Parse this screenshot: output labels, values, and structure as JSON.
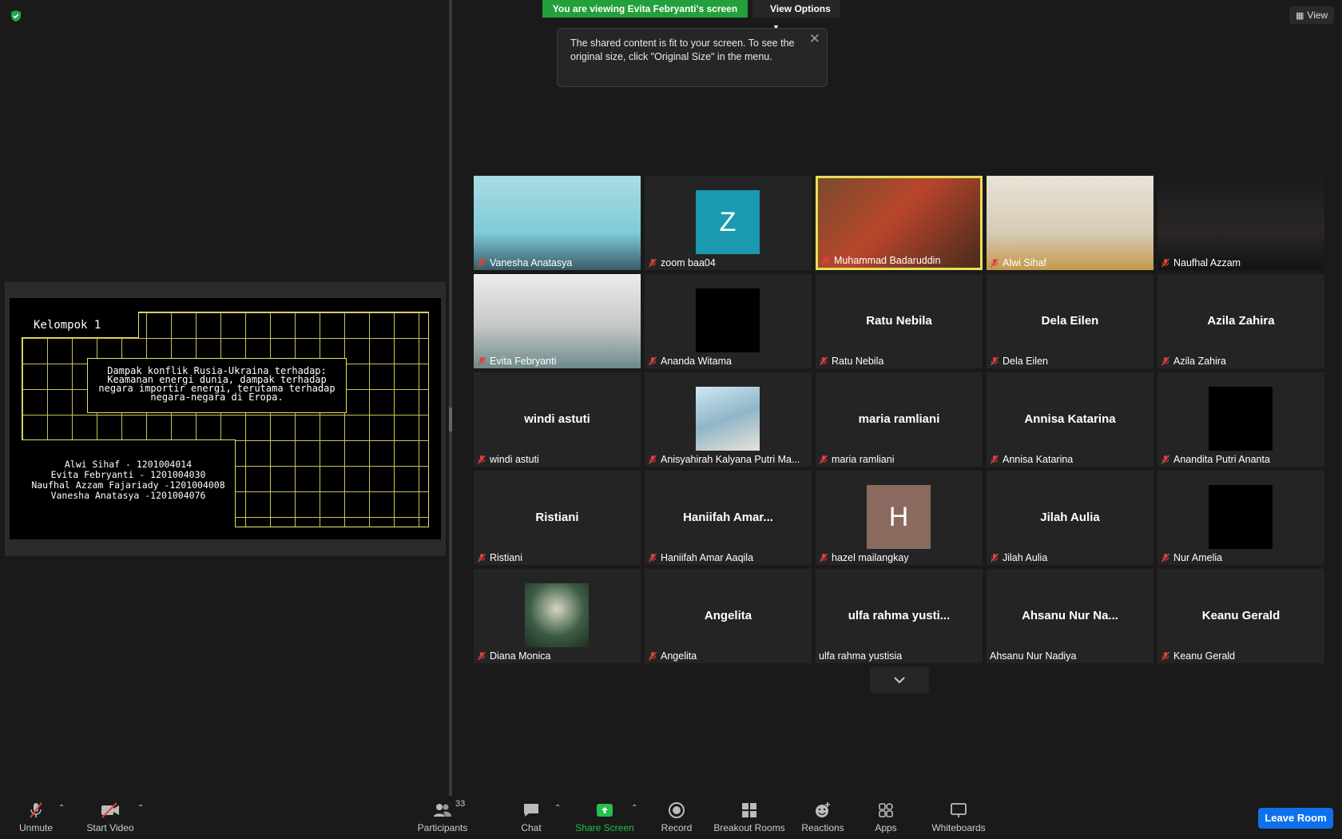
{
  "banner": {
    "viewing": "You are viewing Evita Febryanti's screen",
    "view_options": "View Options"
  },
  "tooltip": {
    "text": "The shared content is fit to your screen. To see the original size, click \"Original Size\" in the menu.",
    "close": "✕"
  },
  "view_button": "View",
  "slide": {
    "title": "Kelompok 1",
    "main": [
      "Dampak konflik Rusia-Ukraina terhadap:",
      "Keamanan energi dunia, dampak terhadap",
      "negara importir energi, terutama terhadap",
      "negara-negara di Eropa."
    ],
    "names": [
      "Alwi Sihaf - 1201004014",
      "Evita Febryanti - 1201004030",
      "Naufhal Azzam Fajariady -1201004008",
      "Vanesha Anatasya -1201004076"
    ]
  },
  "participants": [
    {
      "label": "Vanesha Anatasya",
      "type": "video",
      "muted": true
    },
    {
      "label": "zoom baa04",
      "type": "letter",
      "letter": "Z",
      "color": "#1a9ab0",
      "muted": true
    },
    {
      "label": "Muhammad Badaruddin",
      "type": "video",
      "muted": true,
      "active": true
    },
    {
      "label": "Alwi Sihaf",
      "type": "video",
      "muted": true
    },
    {
      "label": "Naufhal Azzam",
      "type": "video",
      "muted": true
    },
    {
      "label": "Evita Febryanti",
      "type": "video",
      "muted": true
    },
    {
      "label": "Ananda Witama",
      "type": "black",
      "muted": true
    },
    {
      "label": "Ratu Nebila",
      "type": "name",
      "name": "Ratu Nebila",
      "muted": true
    },
    {
      "label": "Dela Eilen",
      "type": "name",
      "name": "Dela Eilen",
      "muted": true
    },
    {
      "label": "Azila Zahira",
      "type": "name",
      "name": "Azila Zahira",
      "muted": true
    },
    {
      "label": "windi astuti",
      "type": "name",
      "name": "windi astuti",
      "muted": true
    },
    {
      "label": "Anisyahirah Kalyana Putri Ma...",
      "type": "photo",
      "muted": true
    },
    {
      "label": "maria ramliani",
      "type": "name",
      "name": "maria ramliani",
      "muted": true
    },
    {
      "label": "Annisa Katarina",
      "type": "name",
      "name": "Annisa Katarina",
      "muted": true
    },
    {
      "label": "Anandita Putri Ananta",
      "type": "black",
      "muted": true
    },
    {
      "label": "Ristiani",
      "type": "name",
      "name": "Ristiani",
      "muted": true
    },
    {
      "label": "Haniifah Amar Aaqila",
      "type": "name",
      "name": "Haniifah  Amar...",
      "muted": true
    },
    {
      "label": "hazel mailangkay",
      "type": "letter",
      "letter": "H",
      "color": "#8a6a5e",
      "muted": true
    },
    {
      "label": "Jilah Aulia",
      "type": "name",
      "name": "Jilah Aulia",
      "muted": true
    },
    {
      "label": "Nur Amelia",
      "type": "black",
      "muted": true
    },
    {
      "label": "Diana Monica",
      "type": "photo2",
      "muted": true
    },
    {
      "label": "Angelita",
      "type": "name",
      "name": "Angelita",
      "muted": true
    },
    {
      "label": "ulfa rahma yustisia",
      "type": "name",
      "name": "ulfa rahma yusti...",
      "muted": false
    },
    {
      "label": "Ahsanu Nur Nadiya",
      "type": "name",
      "name": "Ahsanu Nur Na...",
      "muted": false
    },
    {
      "label": "Keanu Gerald",
      "type": "name",
      "name": "Keanu Gerald",
      "muted": true
    }
  ],
  "toolbar": {
    "unmute": "Unmute",
    "start_video": "Start Video",
    "participants": "Participants",
    "participants_count": "33",
    "chat": "Chat",
    "share_screen": "Share Screen",
    "record": "Record",
    "breakout_rooms": "Breakout Rooms",
    "reactions": "Reactions",
    "apps": "Apps",
    "whiteboards": "Whiteboards",
    "leave": "Leave Room"
  },
  "colors": {
    "banner": "#23a03b",
    "leave": "#0e71eb",
    "active_speaker": "#e3e05a",
    "muted_icon": "#e0403a"
  }
}
